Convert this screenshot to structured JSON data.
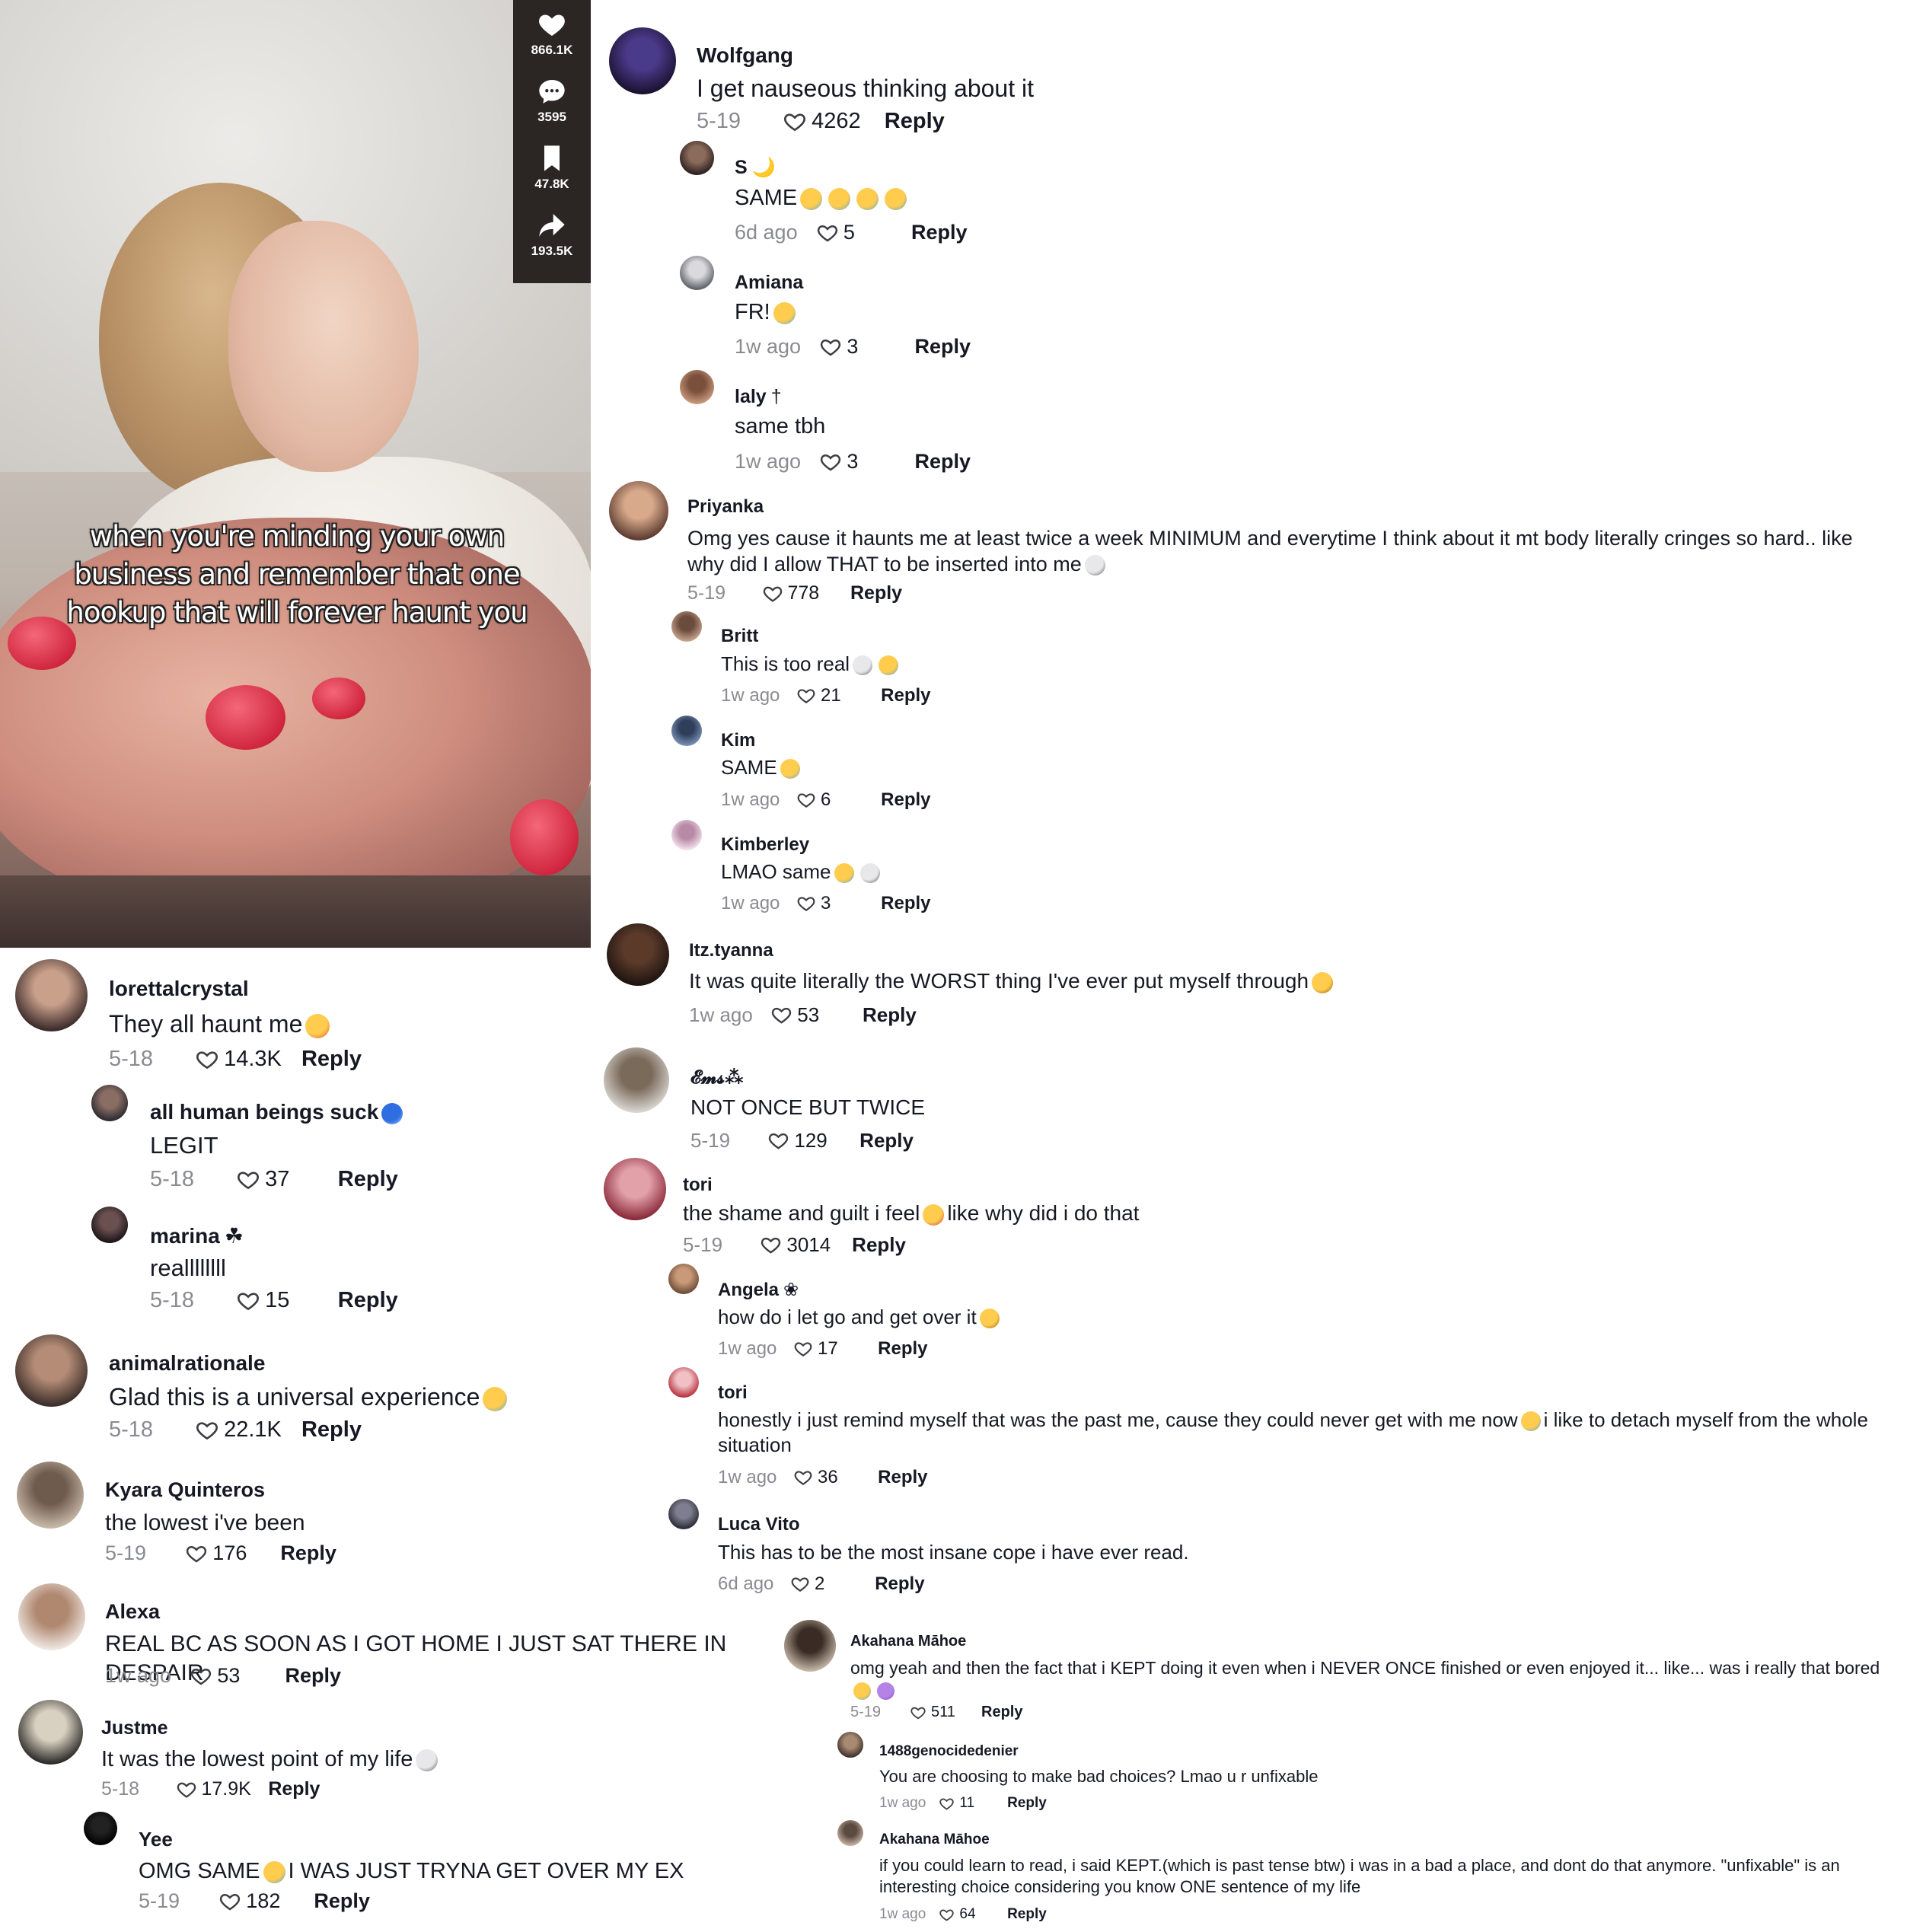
{
  "video": {
    "caption": "when you're minding your own business and remember that one hookup that will forever haunt you",
    "stats": {
      "likes": "866.1K",
      "comments": "3595",
      "saves": "47.8K",
      "shares": "193.5K"
    }
  },
  "comments": [
    {
      "user": "lorettalcrystal",
      "text": "They all haunt me",
      "emoji": "flushed-face",
      "date": "5-18",
      "likes": "14.3K",
      "reply": "Reply"
    },
    {
      "user": "all human beings suck",
      "user_emoji": "cyclone",
      "text": "LEGIT",
      "date": "5-18",
      "likes": "37",
      "reply": "Reply"
    },
    {
      "user": "marina",
      "user_suffix": "☘",
      "text": "reallllllll",
      "date": "5-18",
      "likes": "15",
      "reply": "Reply"
    },
    {
      "user": "animalrationale",
      "text": "Glad this is a universal experience",
      "emoji": "crying-face",
      "date": "5-18",
      "likes": "22.1K",
      "reply": "Reply"
    },
    {
      "user": "Kyara Quinteros",
      "text": "the lowest i've been",
      "date": "5-19",
      "likes": "176",
      "reply": "Reply"
    },
    {
      "user": "Alexa",
      "text": "REAL BC AS SOON AS I GOT HOME I JUST SAT THERE IN DESPAIR",
      "date": "1w ago",
      "likes": "53",
      "reply": "Reply"
    },
    {
      "user": "Justme",
      "text": "It was the lowest point of my life",
      "emoji": "skull",
      "date": "5-18",
      "likes": "17.9K",
      "reply": "Reply"
    },
    {
      "user": "Yee",
      "text_a": "OMG SAME",
      "emoji": "crying-face",
      "text_b": "I WAS JUST TRYNA GET OVER MY EX",
      "date": "5-19",
      "likes": "182",
      "reply": "Reply"
    },
    {
      "user": "Wolfgang",
      "text": "I get nauseous thinking about it",
      "date": "5-19",
      "likes": "4262",
      "reply": "Reply"
    },
    {
      "user": "S",
      "user_suffix": "🌙",
      "text": "SAME",
      "date": "6d ago",
      "likes": "5",
      "reply": "Reply"
    },
    {
      "user": "Amiana",
      "text": "FR!",
      "date": "1w ago",
      "likes": "3",
      "reply": "Reply"
    },
    {
      "user": "laly",
      "user_suffix": "†",
      "text": "same tbh",
      "date": "1w ago",
      "likes": "3",
      "reply": "Reply"
    },
    {
      "user": "Priyanka",
      "text": "Omg yes cause it haunts me at least twice a week MINIMUM and everytime I think about it mt body literally cringes so hard.. like why did I allow THAT to be inserted into me",
      "date": "5-19",
      "likes": "778",
      "reply": "Reply"
    },
    {
      "user": "Britt",
      "text": "This is too real",
      "date": "1w ago",
      "likes": "21",
      "reply": "Reply"
    },
    {
      "user": "Kim",
      "text": "SAME",
      "date": "1w ago",
      "likes": "6",
      "reply": "Reply"
    },
    {
      "user": "Kimberley",
      "text": "LMAO same",
      "date": "1w ago",
      "likes": "3",
      "reply": "Reply"
    },
    {
      "user": "Itz.tyanna",
      "text": "It was quite literally the WORST thing I've ever put myself through",
      "date": "1w ago",
      "likes": "53",
      "reply": "Reply"
    },
    {
      "user": "𝓔𝓶𝓼⁂",
      "text": "NOT ONCE BUT TWICE",
      "date": "5-19",
      "likes": "129",
      "reply": "Reply"
    },
    {
      "user": "tori",
      "text_a": "the shame and guilt i feel",
      "text_b": "like why did i do that",
      "date": "5-19",
      "likes": "3014",
      "reply": "Reply"
    },
    {
      "user": "Angela",
      "user_suffix": "❀",
      "text": "how do i let go and get over it",
      "date": "1w ago",
      "likes": "17",
      "reply": "Reply"
    },
    {
      "user": "tori",
      "text_a": "honestly i just remind myself that was the past me, cause they could never get with me now",
      "text_b": "i like to detach myself from the whole situation",
      "date": "1w ago",
      "likes": "36",
      "reply": "Reply"
    },
    {
      "user": "Luca Vito",
      "text": "This has to be the most insane cope i have ever read.",
      "date": "6d ago",
      "likes": "2",
      "reply": "Reply"
    },
    {
      "user": "Akahana Māhoe",
      "text": "omg yeah and then the fact that i KEPT doing it even when i NEVER ONCE finished or even enjoyed it... like... was i really that bored",
      "date": "5-19",
      "likes": "511",
      "reply": "Reply"
    },
    {
      "user": "1488genocidedenier",
      "text": "You are choosing to make bad choices? Lmao u r unfixable",
      "date": "1w ago",
      "likes": "11",
      "reply": "Reply"
    },
    {
      "user": "Akahana Māhoe",
      "text": "if you could learn to read, i said KEPT.(which is past tense btw) i was in a bad a place, and dont do that anymore. \"unfixable\" is an interesting choice considering you know ONE sentence of my life",
      "date": "1w ago",
      "likes": "64",
      "reply": "Reply"
    }
  ]
}
